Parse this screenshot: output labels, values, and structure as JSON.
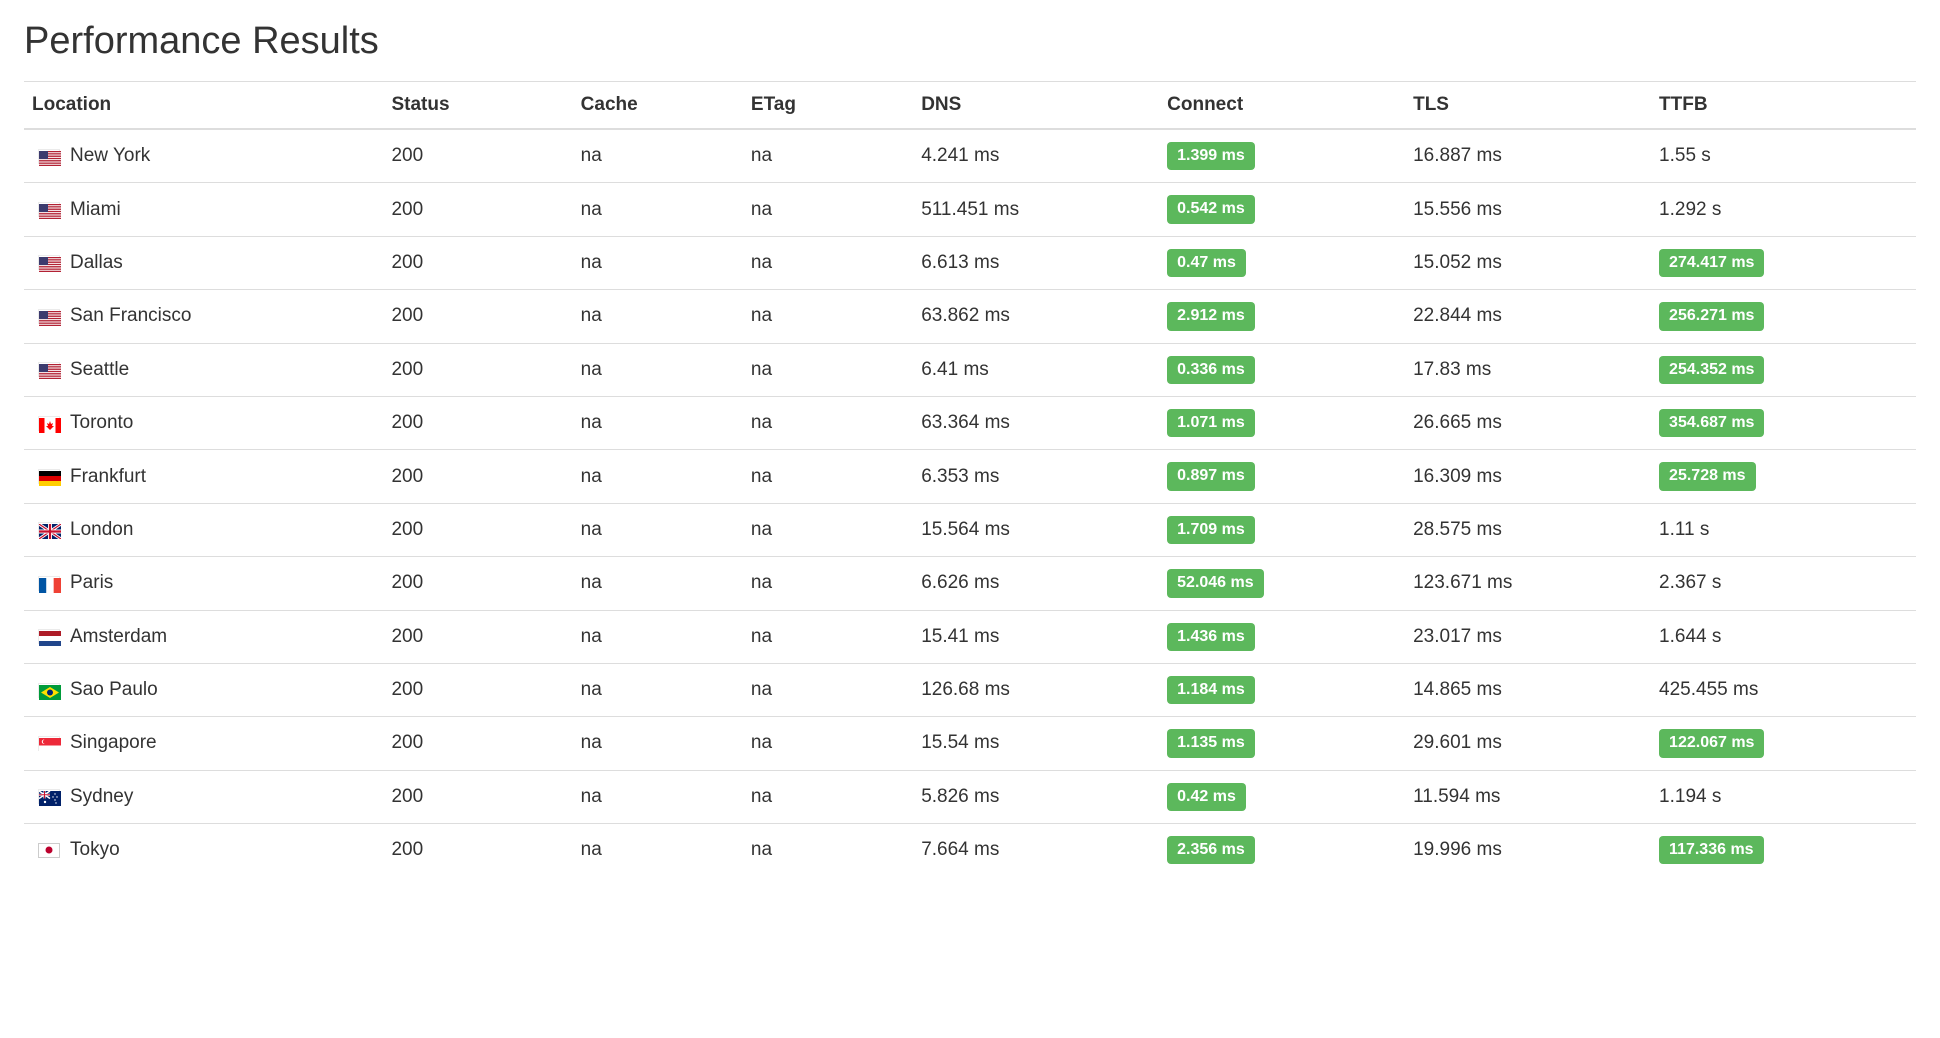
{
  "title": "Performance Results",
  "columns": [
    "Location",
    "Status",
    "Cache",
    "ETag",
    "DNS",
    "Connect",
    "TLS",
    "TTFB"
  ],
  "rows": [
    {
      "flag": "us",
      "location": "New York",
      "status": "200",
      "cache": "na",
      "etag": "na",
      "dns": "4.241 ms",
      "connect": "1.399 ms",
      "connect_badge": true,
      "tls": "16.887 ms",
      "ttfb": "1.55 s",
      "ttfb_badge": false
    },
    {
      "flag": "us",
      "location": "Miami",
      "status": "200",
      "cache": "na",
      "etag": "na",
      "dns": "511.451 ms",
      "connect": "0.542 ms",
      "connect_badge": true,
      "tls": "15.556 ms",
      "ttfb": "1.292 s",
      "ttfb_badge": false
    },
    {
      "flag": "us",
      "location": "Dallas",
      "status": "200",
      "cache": "na",
      "etag": "na",
      "dns": "6.613 ms",
      "connect": "0.47 ms",
      "connect_badge": true,
      "tls": "15.052 ms",
      "ttfb": "274.417 ms",
      "ttfb_badge": true
    },
    {
      "flag": "us",
      "location": "San Francisco",
      "status": "200",
      "cache": "na",
      "etag": "na",
      "dns": "63.862 ms",
      "connect": "2.912 ms",
      "connect_badge": true,
      "tls": "22.844 ms",
      "ttfb": "256.271 ms",
      "ttfb_badge": true
    },
    {
      "flag": "us",
      "location": "Seattle",
      "status": "200",
      "cache": "na",
      "etag": "na",
      "dns": "6.41 ms",
      "connect": "0.336 ms",
      "connect_badge": true,
      "tls": "17.83 ms",
      "ttfb": "254.352 ms",
      "ttfb_badge": true
    },
    {
      "flag": "ca",
      "location": "Toronto",
      "status": "200",
      "cache": "na",
      "etag": "na",
      "dns": "63.364 ms",
      "connect": "1.071 ms",
      "connect_badge": true,
      "tls": "26.665 ms",
      "ttfb": "354.687 ms",
      "ttfb_badge": true
    },
    {
      "flag": "de",
      "location": "Frankfurt",
      "status": "200",
      "cache": "na",
      "etag": "na",
      "dns": "6.353 ms",
      "connect": "0.897 ms",
      "connect_badge": true,
      "tls": "16.309 ms",
      "ttfb": "25.728 ms",
      "ttfb_badge": true
    },
    {
      "flag": "gb",
      "location": "London",
      "status": "200",
      "cache": "na",
      "etag": "na",
      "dns": "15.564 ms",
      "connect": "1.709 ms",
      "connect_badge": true,
      "tls": "28.575 ms",
      "ttfb": "1.11 s",
      "ttfb_badge": false
    },
    {
      "flag": "fr",
      "location": "Paris",
      "status": "200",
      "cache": "na",
      "etag": "na",
      "dns": "6.626 ms",
      "connect": "52.046 ms",
      "connect_badge": true,
      "tls": "123.671 ms",
      "ttfb": "2.367 s",
      "ttfb_badge": false
    },
    {
      "flag": "nl",
      "location": "Amsterdam",
      "status": "200",
      "cache": "na",
      "etag": "na",
      "dns": "15.41 ms",
      "connect": "1.436 ms",
      "connect_badge": true,
      "tls": "23.017 ms",
      "ttfb": "1.644 s",
      "ttfb_badge": false
    },
    {
      "flag": "br",
      "location": "Sao Paulo",
      "status": "200",
      "cache": "na",
      "etag": "na",
      "dns": "126.68 ms",
      "connect": "1.184 ms",
      "connect_badge": true,
      "tls": "14.865 ms",
      "ttfb": "425.455 ms",
      "ttfb_badge": false
    },
    {
      "flag": "sg",
      "location": "Singapore",
      "status": "200",
      "cache": "na",
      "etag": "na",
      "dns": "15.54 ms",
      "connect": "1.135 ms",
      "connect_badge": true,
      "tls": "29.601 ms",
      "ttfb": "122.067 ms",
      "ttfb_badge": true
    },
    {
      "flag": "au",
      "location": "Sydney",
      "status": "200",
      "cache": "na",
      "etag": "na",
      "dns": "5.826 ms",
      "connect": "0.42 ms",
      "connect_badge": true,
      "tls": "11.594 ms",
      "ttfb": "1.194 s",
      "ttfb_badge": false
    },
    {
      "flag": "jp",
      "location": "Tokyo",
      "status": "200",
      "cache": "na",
      "etag": "na",
      "dns": "7.664 ms",
      "connect": "2.356 ms",
      "connect_badge": true,
      "tls": "19.996 ms",
      "ttfb": "117.336 ms",
      "ttfb_badge": true
    }
  ]
}
